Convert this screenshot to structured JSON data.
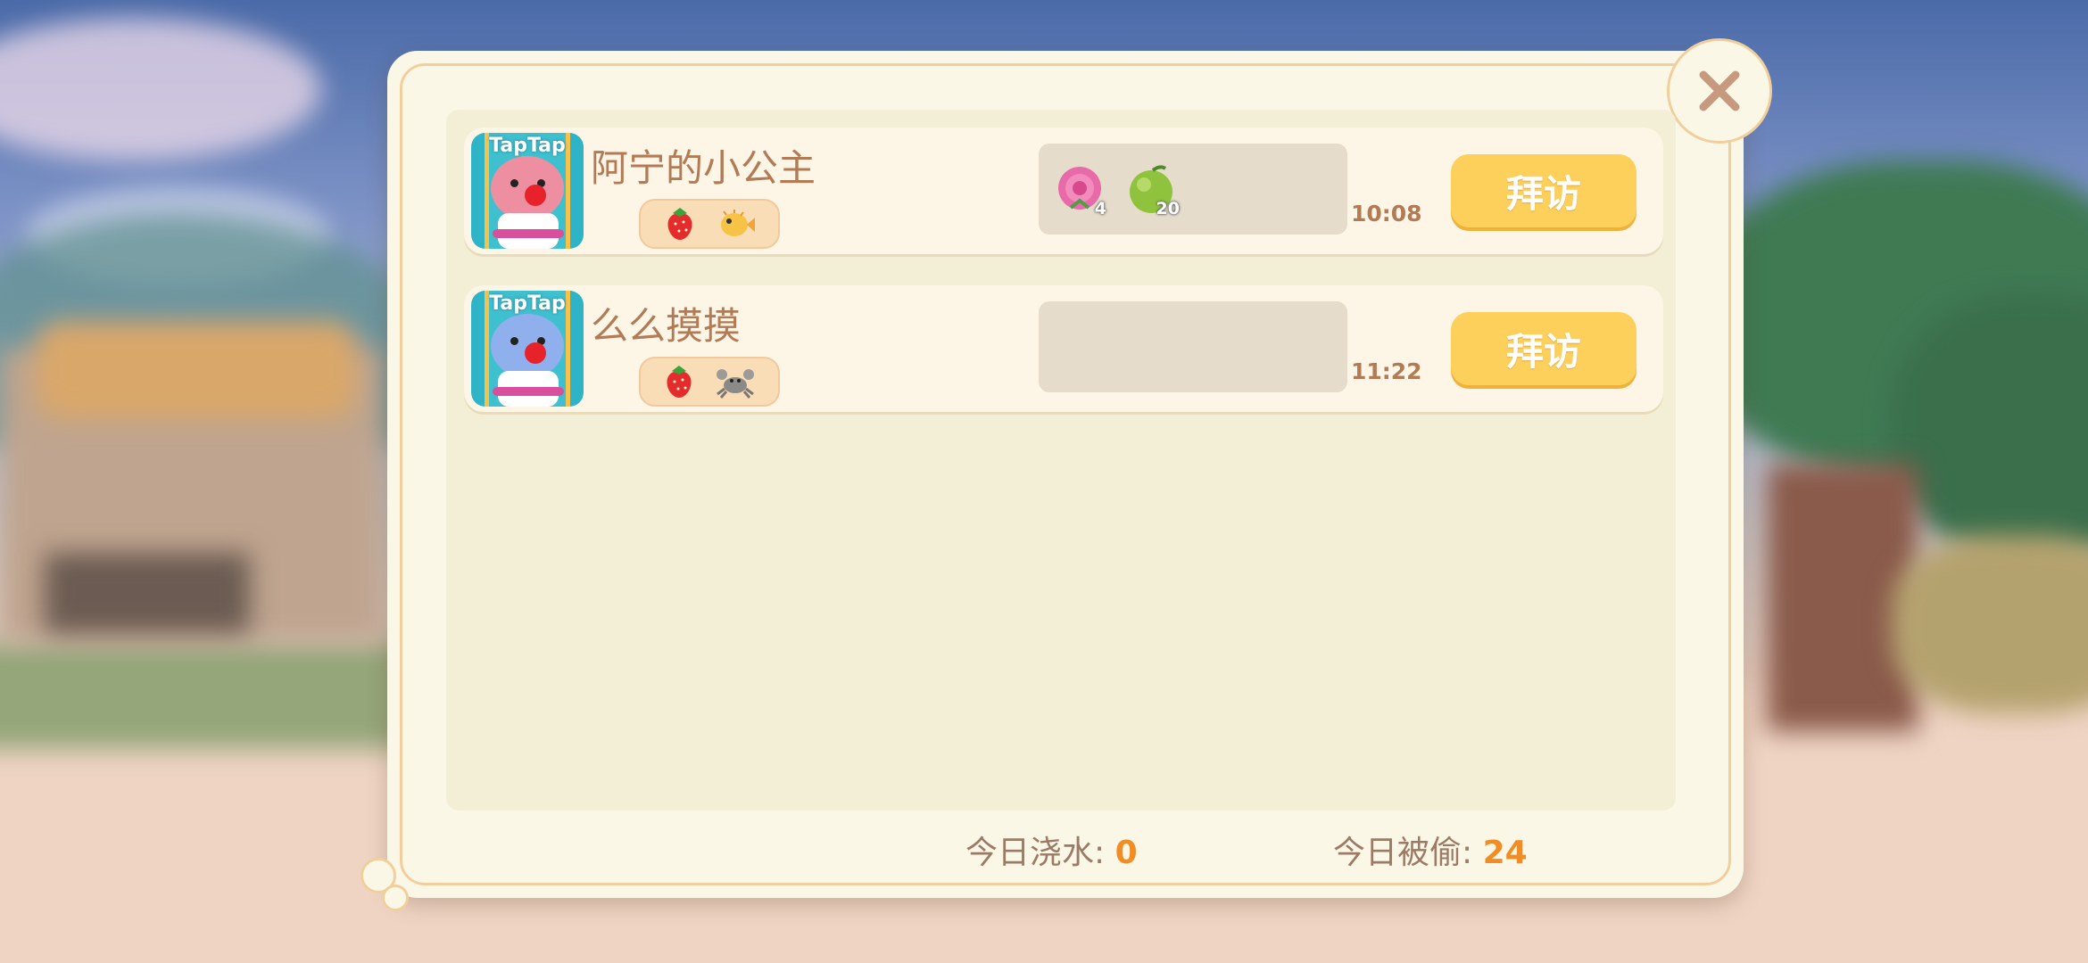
{
  "dialog": {
    "close_icon": "close-icon",
    "friends": [
      {
        "name": "阿宁的小公主",
        "avatar_badge": "TapTap",
        "avatar_color": "pink",
        "tag_icons": [
          "strawberry-icon",
          "pufferfish-icon"
        ],
        "gifts": [
          {
            "icon": "rose-icon",
            "count": "4"
          },
          {
            "icon": "lime-icon",
            "count": "20"
          }
        ],
        "time": "10:08",
        "visit_label": "拜访"
      },
      {
        "name": "么么摸摸",
        "avatar_badge": "TapTap",
        "avatar_color": "blue",
        "tag_icons": [
          "strawberry-icon",
          "crab-icon"
        ],
        "gifts": [],
        "time": "11:22",
        "visit_label": "拜访"
      }
    ],
    "stats": {
      "water_label": "今日浇水:",
      "water_value": "0",
      "stolen_label": "今日被偷:",
      "stolen_value": "24"
    }
  },
  "colors": {
    "accent": "#fdd05c",
    "name_text": "#b27a55",
    "stat_number": "#f08d25"
  }
}
